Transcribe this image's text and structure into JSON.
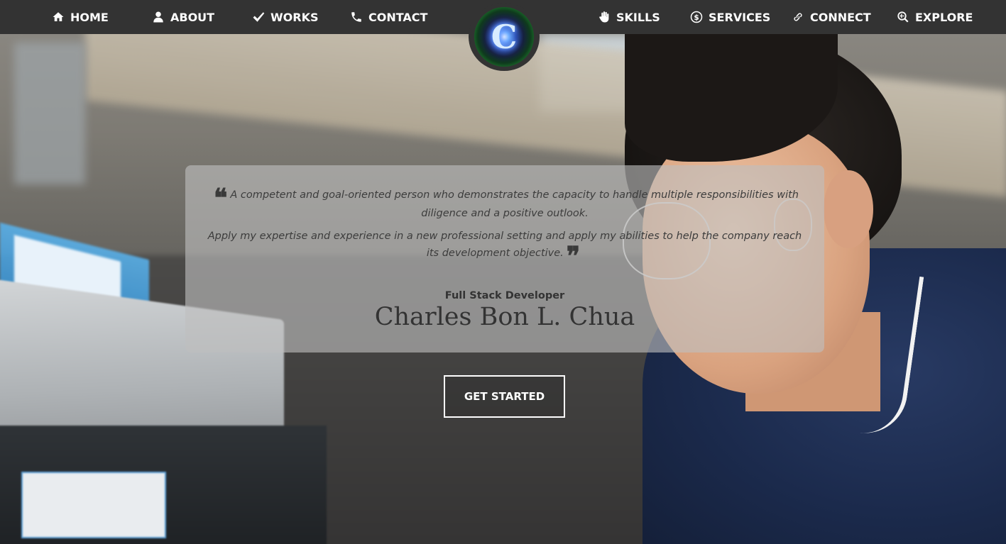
{
  "nav": {
    "left": [
      {
        "label": "HOME",
        "icon": "home-icon"
      },
      {
        "label": "ABOUT",
        "icon": "person-icon"
      },
      {
        "label": "WORKS",
        "icon": "checkmark-icon"
      },
      {
        "label": "CONTACT",
        "icon": "phone-icon"
      }
    ],
    "right": [
      {
        "label": "SKILLS",
        "icon": "hand-icon"
      },
      {
        "label": "SERVICES",
        "icon": "dollar-coin-icon"
      },
      {
        "label": "CONNECT",
        "icon": "link-icon"
      },
      {
        "label": "EXPLORE",
        "icon": "search-globe-icon"
      }
    ],
    "logo_letter": "C"
  },
  "hero": {
    "quote_paragraph_1": "A competent and goal-oriented person who demonstrates the capacity to handle multiple responsibilities with diligence and a positive outlook.",
    "quote_paragraph_2": "Apply my expertise and experience in a new professional setting and apply my abilities to help the company reach its development objective.",
    "open_quote": "❝",
    "close_quote": "❞",
    "role": "Full Stack Developer",
    "name": "Charles Bon L. Chua",
    "cta_label": "GET STARTED"
  },
  "colors": {
    "navbar": "#333333",
    "card": "#bebebe",
    "text": "#333333",
    "cta_border": "#ffffff"
  }
}
